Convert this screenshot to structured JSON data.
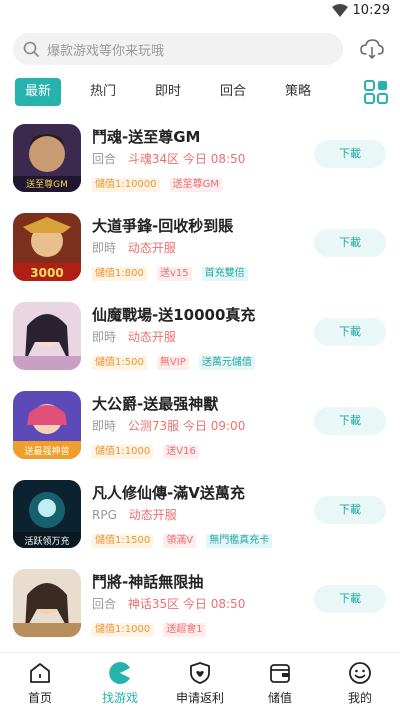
{
  "status_bar": {
    "time": "10:29",
    "wifi_icon": "wifi-icon"
  },
  "search": {
    "placeholder": "爆款游戏等你来玩哦",
    "icon": "search-icon",
    "download_icon": "cloud-download-icon"
  },
  "tabs": [
    {
      "label": "最新",
      "active": true
    },
    {
      "label": "热门",
      "active": false
    },
    {
      "label": "即时",
      "active": false
    },
    {
      "label": "回合",
      "active": false
    },
    {
      "label": "策略",
      "active": false
    }
  ],
  "grid_icon": "category-grid-icon",
  "games": [
    {
      "title": "鬥魂-送至尊GM",
      "genre": "回合",
      "server": "斗魂34区 今日 08:50",
      "tags": [
        {
          "text": "儲值1:10000",
          "style": "orange"
        },
        {
          "text": "送至尊GM",
          "style": "red"
        }
      ],
      "button": "下載"
    },
    {
      "title": "大道爭鋒-回收秒到賬",
      "genre": "即時",
      "server": "动态开服",
      "tags": [
        {
          "text": "儲值1:800",
          "style": "orange"
        },
        {
          "text": "送v15",
          "style": "red"
        },
        {
          "text": "首充雙倍",
          "style": "teal"
        }
      ],
      "button": "下載"
    },
    {
      "title": "仙魔戰場-送10000真充",
      "genre": "即時",
      "server": "动态开服",
      "tags": [
        {
          "text": "儲值1:500",
          "style": "orange"
        },
        {
          "text": "無VIP",
          "style": "red"
        },
        {
          "text": "送萬元儲值",
          "style": "teal"
        }
      ],
      "button": "下載"
    },
    {
      "title": "大公爵-送最强神獸",
      "genre": "即時",
      "server": "公测73服 今日 09:00",
      "tags": [
        {
          "text": "儲值1:1000",
          "style": "orange"
        },
        {
          "text": "送V16",
          "style": "red"
        }
      ],
      "button": "下載"
    },
    {
      "title": "凡人修仙傳-滿V送萬充",
      "genre": "RPG",
      "server": "动态开服",
      "tags": [
        {
          "text": "儲值1:1500",
          "style": "orange"
        },
        {
          "text": "領滿V",
          "style": "red"
        },
        {
          "text": "無門檻真充卡",
          "style": "teal"
        }
      ],
      "button": "下載"
    },
    {
      "title": "鬥將-神話無限抽",
      "genre": "回合",
      "server": "神话35区 今日 08:50",
      "tags": [
        {
          "text": "儲值1:1000",
          "style": "orange"
        },
        {
          "text": "送超會1",
          "style": "red"
        }
      ],
      "button": "下載"
    }
  ],
  "bottom_nav": [
    {
      "label": "首页",
      "icon": "home-icon",
      "active": false
    },
    {
      "label": "找游戏",
      "icon": "find-game-icon",
      "active": true
    },
    {
      "label": "申请返利",
      "icon": "rebate-icon",
      "active": false
    },
    {
      "label": "储值",
      "icon": "wallet-icon",
      "active": false
    },
    {
      "label": "我的",
      "icon": "profile-icon",
      "active": false
    }
  ],
  "colors": {
    "accent": "#26b3ad",
    "accent_light": "#eaf7f7",
    "tag_orange": "#e8963a",
    "tag_red": "#ef6f6f",
    "tag_teal": "#26a9a3"
  }
}
